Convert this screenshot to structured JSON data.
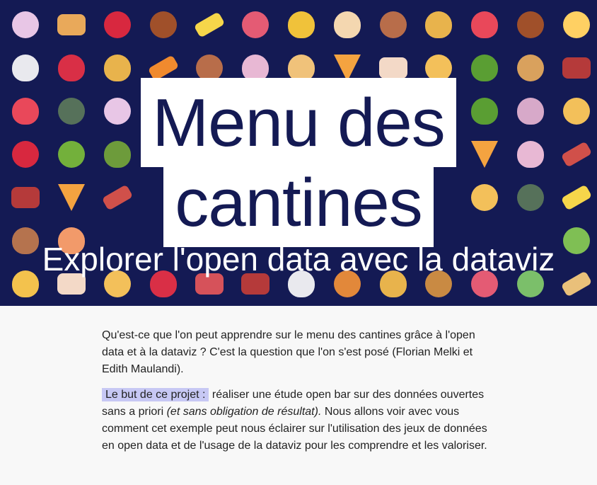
{
  "hero": {
    "title_line1": "Menu des",
    "title_line2": "cantines",
    "subtitle": "Explorer l'open data avec la dataviz",
    "background_color": "#141a54",
    "emoji_icons": [
      "lollipop-icon",
      "pancakes-icon",
      "apple-icon",
      "meatballs-icon",
      "banana-icon",
      "candy-icon",
      "pineapple-icon",
      "ice-cream-icon",
      "donut-icon",
      "taco-icon",
      "watermelon-icon",
      "meatballs-icon",
      "baby-icon",
      "rice-ball-icon",
      "strawberry-icon",
      "taco-icon",
      "carrot-icon",
      "donut-icon",
      "cupcake-icon",
      "fortune-cookie-icon",
      "pizza-icon",
      "cake-icon",
      "person-icon",
      "broccoli-icon",
      "pie-icon",
      "bento-icon",
      "watermelon-icon",
      "soup-bowl-icon",
      "lollipop-icon",
      "cheese-icon",
      "",
      "",
      "",
      "",
      "",
      "",
      "broccoli-icon",
      "ice-cream-bowl-icon",
      "person-icon",
      "apple-icon",
      "green-apple-icon",
      "avocado-icon",
      "",
      "",
      "",
      "",
      "",
      "",
      "",
      "pizza-icon",
      "cupcake-icon",
      "bacon-icon",
      "bento-icon",
      "pizza-icon",
      "bacon-icon",
      "",
      "",
      "",
      "",
      "",
      "",
      "",
      "person-icon",
      "soup-bowl-icon",
      "banana-icon",
      "sweet-potato-icon",
      "shrimp-icon",
      "",
      "",
      "",
      "",
      "",
      "",
      "",
      "",
      "",
      "",
      "melon-icon",
      "custard-icon",
      "cake-icon",
      "person-icon",
      "strawberry-icon",
      "sushi-icon",
      "bento-icon",
      "rice-ball-icon",
      "mango-icon",
      "taco-icon",
      "burger-icon",
      "candy-icon",
      "salad-icon",
      "sandwich-icon"
    ]
  },
  "content": {
    "intro": "Qu'est-ce que l'on peut apprendre sur le menu des cantines grâce à l'open data et à la dataviz ? C'est la question que l'on s'est posé (Florian Melki et Edith Maulandi).",
    "goal_label": "Le but de ce projet :",
    "goal_text_1": " réaliser une étude open bar sur des données ouvertes sans a priori ",
    "goal_text_italic": "(et sans obligation de résultat).",
    "goal_text_2": " Nous allons voir avec vous comment cet exemple peut nous éclairer sur l'utilisation des jeux de données en open data et de l'usage de la dataviz pour les comprendre et les valoriser.",
    "highlight_color": "#c7c8f4"
  }
}
